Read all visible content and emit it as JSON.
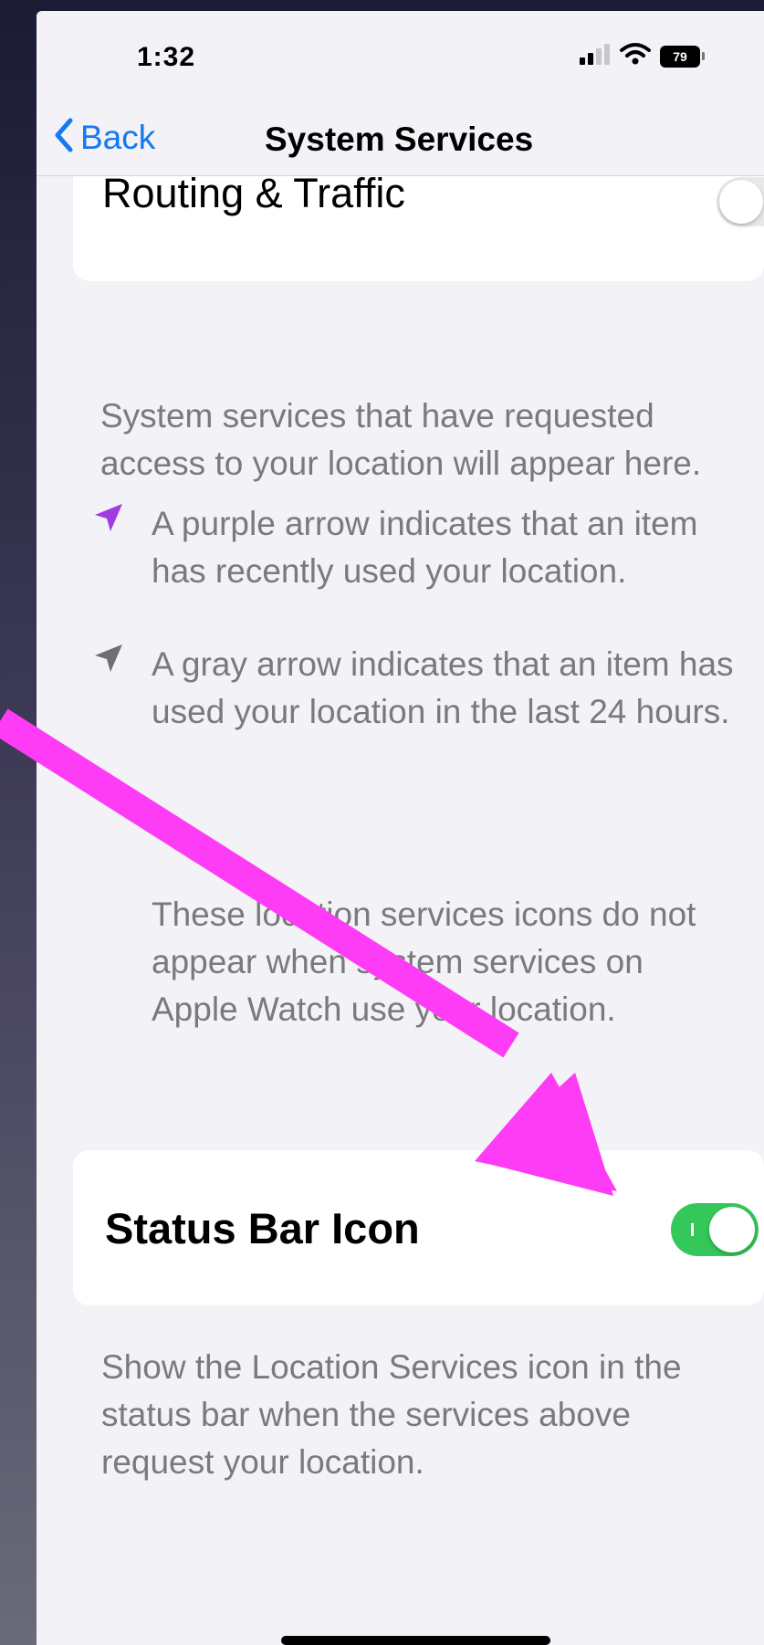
{
  "status_bar": {
    "time": "1:32",
    "battery": "79"
  },
  "nav": {
    "back_label": "Back",
    "title": "System Services"
  },
  "routing": {
    "label": "Routing & Traffic",
    "enabled": false
  },
  "info": {
    "intro": "System services that have requested access to your location will appear here.",
    "purple_arrow": "A purple arrow indicates that an item has recently used your location.",
    "gray_arrow": "A gray arrow indicates that an item has used your location in the last 24 hours.",
    "watch_note": "These location services icons do not appear when system services on Apple Watch use your location."
  },
  "status_bar_icon": {
    "label": "Status Bar Icon",
    "enabled": true
  },
  "footer": {
    "text": "Show the Location Services icon in the status bar when the services above request your location."
  },
  "colors": {
    "accent_blue": "#1479f2",
    "toggle_on": "#34c759",
    "purple_arrow": "#a23ae0",
    "gray_arrow": "#6e6e73",
    "annotation_magenta": "#ff3cf5"
  },
  "icons": {
    "back": "chevron-left-icon",
    "purple": "location-arrow-icon",
    "gray": "location-arrow-icon"
  }
}
